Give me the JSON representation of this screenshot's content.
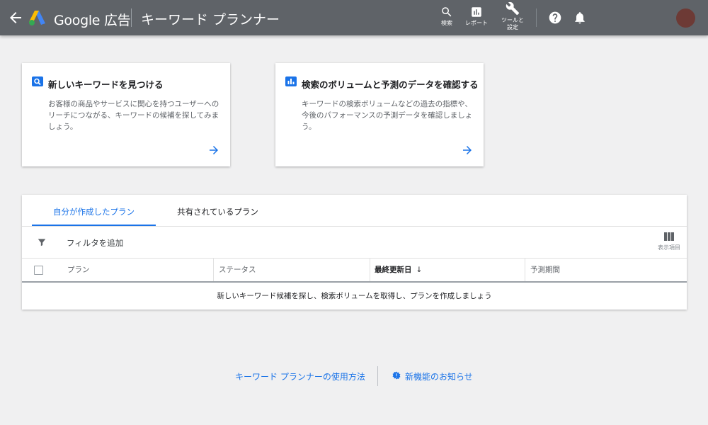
{
  "header": {
    "brand": "Google 広告",
    "title": "キーワード プランナー",
    "tools": [
      {
        "label": "検索",
        "icon": "search-icon"
      },
      {
        "label": "レポート",
        "icon": "report-icon"
      },
      {
        "label": "ツールと\n設定",
        "icon": "wrench-icon"
      }
    ],
    "help_icon": "help-icon",
    "notifications_icon": "bell-icon"
  },
  "cards": [
    {
      "title": "新しいキーワードを見つける",
      "description": "お客様の商品やサービスに関心を持つユーザーへのリーチにつながる、キーワードの候補を探してみましょう。",
      "icon": "search-icon"
    },
    {
      "title": "検索のボリュームと予測のデータを確認する",
      "description": "キーワードの検索ボリュームなどの過去の指標や、今後のパフォーマンスの予測データを確認しましょう。",
      "icon": "bar-chart-icon"
    }
  ],
  "plans": {
    "tabs": [
      {
        "label": "自分が作成したプラン",
        "active": true
      },
      {
        "label": "共有されているプラン",
        "active": false
      }
    ],
    "filter_label": "フィルタを追加",
    "columns_label": "表示項目",
    "columns": [
      {
        "label": "プラン"
      },
      {
        "label": "ステータス"
      },
      {
        "label": "最終更新日",
        "sorted": "desc"
      },
      {
        "label": "予測期間"
      }
    ],
    "sort_arrow": "↓",
    "empty_message": "新しいキーワード候補を探し、検索ボリュームを取得し、プランを作成しましょう"
  },
  "footer": {
    "how_to": "キーワード プランナーの使用方法",
    "news": "新機能のお知らせ"
  },
  "colors": {
    "header_bg": "#5f6368",
    "accent": "#1a73e8",
    "page_bg": "#f0f0f1"
  }
}
